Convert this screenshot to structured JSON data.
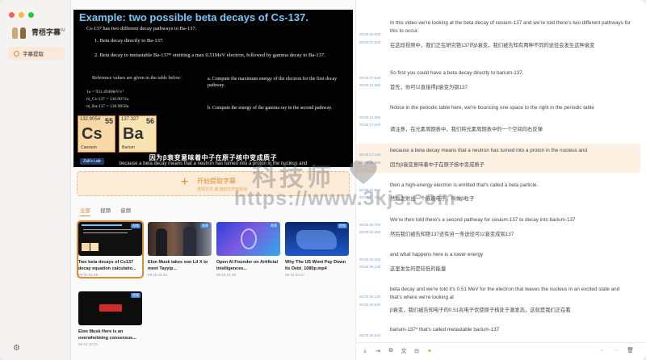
{
  "app": {
    "name": "青梧字幕",
    "badge": "AI"
  },
  "colors": {
    "accent": "#e08b2f",
    "accent_bg": "#fcebd6",
    "timestamp": "#7aa2d6",
    "video_title": "#79c6f5"
  },
  "sidebar": {
    "nav_item": "字幕提取",
    "settings_icon": "gear-icon"
  },
  "video": {
    "title": "Example:  two possible beta decays of Cs-137.",
    "intro": "Cs-137 has two different decay pathways to Ba-137.",
    "item1": "1.   Beta decay directly to Ba-137.",
    "item2": "2.   Beta decay to metastable Ba-137* emitting a max 0.51MeV electron, followed by gamma decay to Ba-137.",
    "reference": "Reference values are given in the table below:",
    "val1": "1u = 931.494MeV/c²",
    "val2": "m_Cs-137 = 136.9071u",
    "val3": "m_Ba-137 = 136.9058u",
    "question_a": "a.  Compute the maximum energy of the electron for the first decay pathway.",
    "question_b": "b.  Compute the energy of the gamma ray in the second pathway.",
    "cs": {
      "mass": "132.9054",
      "number": "55",
      "symbol": "Cs",
      "name": "Caesium"
    },
    "ba": {
      "mass": "137.327",
      "number": "56",
      "symbol": "Ba",
      "name": "Barium"
    },
    "zeks": "Zak's Lab",
    "subtitle_zh": "因为β衰变意味着中子在原子核中变成质子",
    "subtitle_en": "because a beta decay means that a neutron has turned into a proton in the nucleus and"
  },
  "upload": {
    "title": "开始提取字幕",
    "hint": "选择文件 或 拖动文件到此处"
  },
  "filters": [
    "全部",
    "视频",
    "音频"
  ],
  "media": [
    {
      "title": "Two beta decays of Cs137 decay equation calculatio...",
      "date": "09-20 01:26",
      "badge": "视频"
    },
    {
      "title": "Elon Musk takes son Lil X to meet Tayyip...",
      "date": "09-18 15:34",
      "badge": "视频"
    },
    {
      "title": "Open AI Founder on Artificial Intelligences...",
      "date": "09-18 01:45",
      "badge": "视频"
    },
    {
      "title": "Why The US Wont Pay Down Its Debt_1080p.mp4",
      "date": "09-15 03:17",
      "badge": "视频"
    },
    {
      "title": "Elon Musk Here is an overwhelming consensus...",
      "date": "09-14 15:23",
      "badge": "视频"
    }
  ],
  "transcript": [
    {
      "start": "00:00:00,000",
      "end": "00:00:07,620",
      "en": "In this video we're looking at the beta decay of cesium-137 and we're told there's two different pathways for this to occur.",
      "zh": "在这段视频中，我们正在研究铯137的β衰变，我们被告知有两种不同的途径会发生这种衰变"
    },
    {
      "start": "00:00:07,620",
      "end": "00:00:12,360",
      "en": "So first you could have a beta decay directly to barium-137.",
      "zh": "首先，你可以直接得β衰变为钡137"
    },
    {
      "start": "00:00:12,360",
      "end": "00:00:17,440",
      "en": "Notice in the periodic table here, we're bouncing one space to the right in the periodic table",
      "zh": "请注意，在元素周期表中，我们将元素周期表中的一个空间向右反弹"
    },
    {
      "start": "00:00:17,440",
      "end": "00:00:22,860",
      "en": "because a beta decay means that a neutron has turned into a proton in the nucleus and",
      "zh": "因为β衰变意味着中子在原子核中变成质子"
    },
    {
      "start": "00:00:22,860",
      "end": "00:00:26,760",
      "en": "then a high-energy electron is emitted that's called a beta particle.",
      "zh": "然后发射出一个高能电子，叫做β粒子"
    },
    {
      "start": "00:00:26,760",
      "end": "00:00:32,260",
      "en": "We're then told there's a second pathway for cesium-137 to decay into barium-137",
      "zh": "然后我们被告知铯137还有另一条途径可以衰变成钡137"
    },
    {
      "start": "00:00:32,260",
      "end": "00:00:35,130",
      "en": "and what happens here is a lower energy",
      "zh": "这里发生的是较低的能量"
    },
    {
      "start": "00:00:35,130",
      "end": "00:00:40,640",
      "en": "beta decay and we're told it's 0.51 MeV for the electron that leaves the nucleus in an excited state and that's where we're looking at",
      "zh": "β衰变，我们被告知电子的0.51兆电子伏使原子核处于激发态，这就是我们正在看"
    },
    {
      "start": "00:00:40,640",
      "end": "00:00:44,000",
      "en": "barium-137* that's called metastable barium-137",
      "zh": ""
    }
  ],
  "toolbar": {
    "icons": [
      "download-icon",
      "export-icon",
      "copy-icon",
      "translate-icon",
      "split-icon",
      "star-icon"
    ]
  }
}
